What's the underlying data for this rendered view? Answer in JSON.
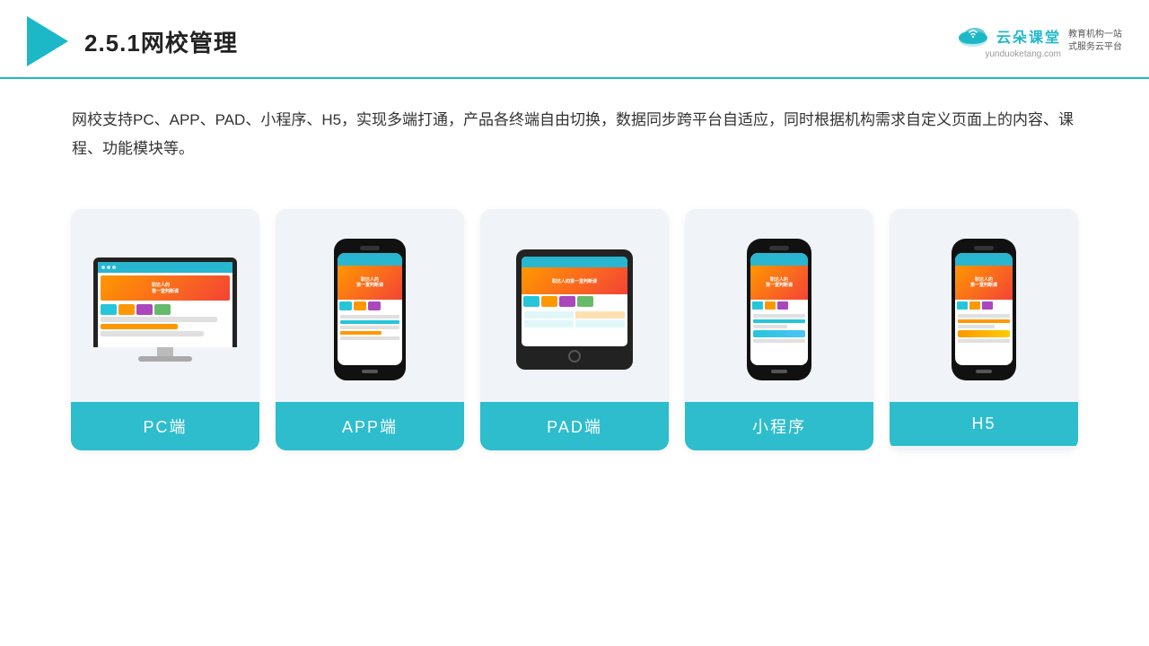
{
  "header": {
    "title": "2.5.1网校管理",
    "brand_name": "云朵课堂",
    "brand_url": "yunduoketang.com",
    "brand_slogan": "教育机构一站\n式服务云平台"
  },
  "description": {
    "text": "网校支持PC、APP、PAD、小程序、H5，实现多端打通，产品各终端自由切换，数据同步跨平台自适应，同时根据机构需求自定义页面上的内容、课程、功能模块等。"
  },
  "cards": [
    {
      "id": "pc",
      "label": "PC端"
    },
    {
      "id": "app",
      "label": "APP端"
    },
    {
      "id": "pad",
      "label": "PAD端"
    },
    {
      "id": "mini",
      "label": "小程序"
    },
    {
      "id": "h5",
      "label": "H5"
    }
  ]
}
